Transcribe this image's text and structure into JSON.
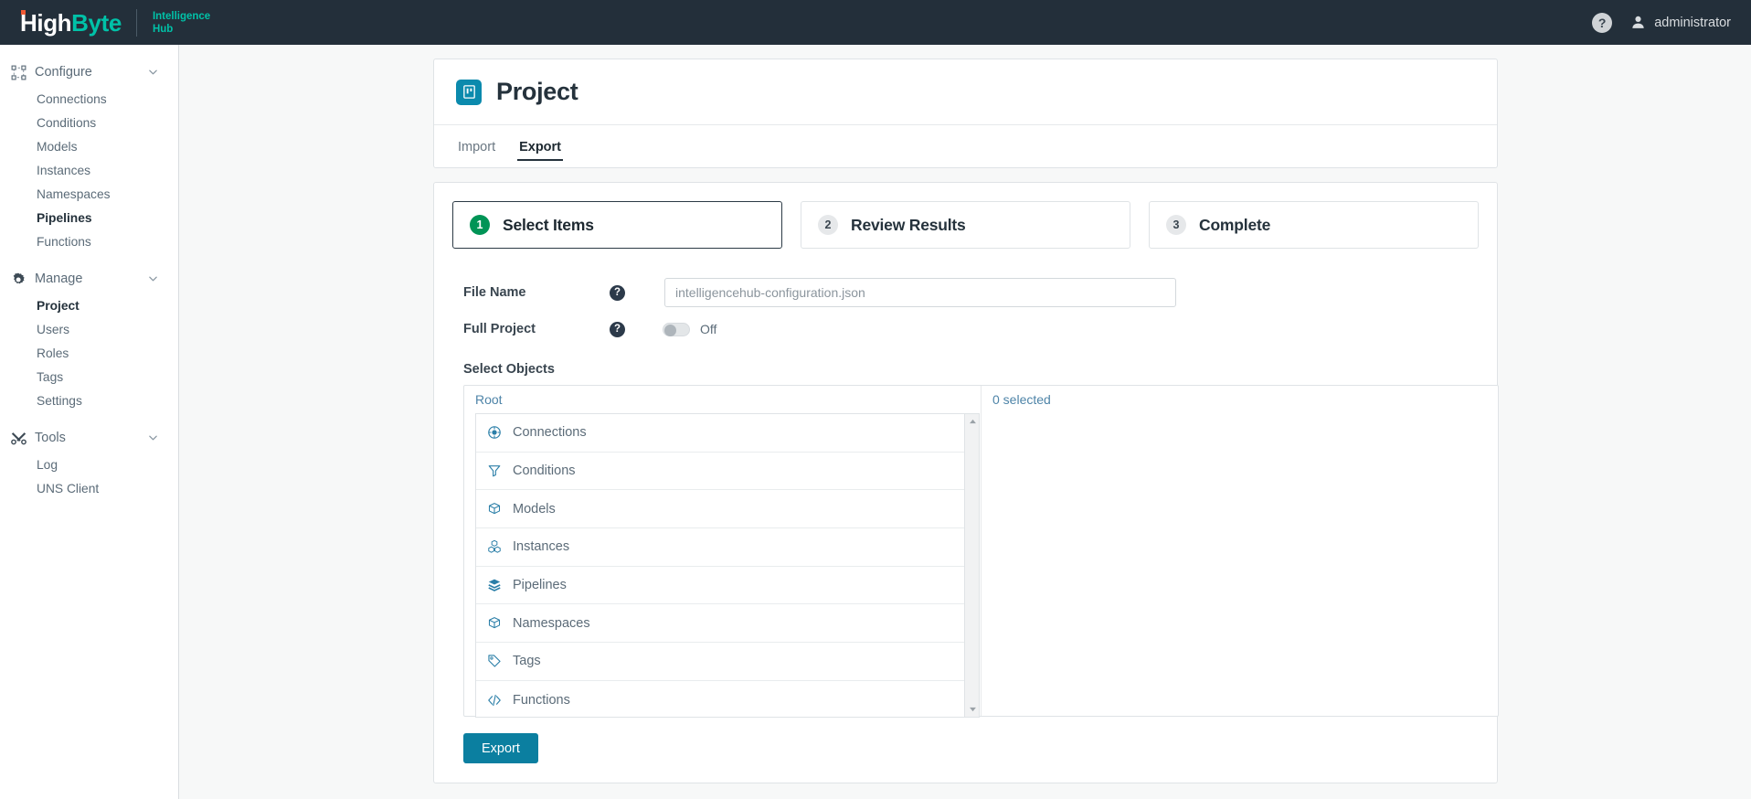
{
  "topbar": {
    "brand_primary": "High",
    "brand_secondary": "Byte",
    "product_line1": "Intelligence",
    "product_line2": "Hub",
    "help_glyph": "?",
    "user_name": "administrator"
  },
  "sidebar": {
    "groups": [
      {
        "label": "Configure",
        "icon": "configure-icon",
        "items": [
          {
            "label": "Connections",
            "active": false
          },
          {
            "label": "Conditions",
            "active": false
          },
          {
            "label": "Models",
            "active": false
          },
          {
            "label": "Instances",
            "active": false
          },
          {
            "label": "Namespaces",
            "active": false
          },
          {
            "label": "Pipelines",
            "active": true
          },
          {
            "label": "Functions",
            "active": false
          }
        ]
      },
      {
        "label": "Manage",
        "icon": "gear-icon",
        "items": [
          {
            "label": "Project",
            "active": true
          },
          {
            "label": "Users",
            "active": false
          },
          {
            "label": "Roles",
            "active": false
          },
          {
            "label": "Tags",
            "active": false
          },
          {
            "label": "Settings",
            "active": false
          }
        ]
      },
      {
        "label": "Tools",
        "icon": "tools-icon",
        "items": [
          {
            "label": "Log",
            "active": false
          },
          {
            "label": "UNS Client",
            "active": false
          }
        ]
      }
    ]
  },
  "page": {
    "title": "Project",
    "icon": "project-icon",
    "tabs": [
      {
        "label": "Import",
        "active": false
      },
      {
        "label": "Export",
        "active": true
      }
    ]
  },
  "wizard": {
    "steps": [
      {
        "number": "1",
        "label": "Select Items",
        "active": true
      },
      {
        "number": "2",
        "label": "Review Results",
        "active": false
      },
      {
        "number": "3",
        "label": "Complete",
        "active": false
      }
    ]
  },
  "form": {
    "file_name": {
      "label": "File Name",
      "help_glyph": "?",
      "value": "",
      "placeholder": "intelligencehub-configuration.json"
    },
    "full_project": {
      "label": "Full Project",
      "help_glyph": "?",
      "state_label": "Off",
      "on": false
    },
    "select_objects_label": "Select Objects"
  },
  "tree": {
    "root_label": "Root",
    "selected_label": "0 selected",
    "items": [
      {
        "label": "Connections",
        "icon": "connection-icon"
      },
      {
        "label": "Conditions",
        "icon": "filter-icon"
      },
      {
        "label": "Models",
        "icon": "box-outline-icon"
      },
      {
        "label": "Instances",
        "icon": "cubes-icon"
      },
      {
        "label": "Pipelines",
        "icon": "layers-icon"
      },
      {
        "label": "Namespaces",
        "icon": "box-outline-icon"
      },
      {
        "label": "Tags",
        "icon": "tag-icon"
      },
      {
        "label": "Functions",
        "icon": "code-icon"
      }
    ]
  },
  "actions": {
    "export_label": "Export"
  },
  "colors": {
    "topbar_bg": "#232f3a",
    "brand_teal": "#00c2a8",
    "brand_dot": "#f05a35",
    "accent_teal": "#0b7fa0",
    "step_active_green": "#009456",
    "link_blue": "#4e84a8",
    "page_bg": "#f7f8f8"
  }
}
